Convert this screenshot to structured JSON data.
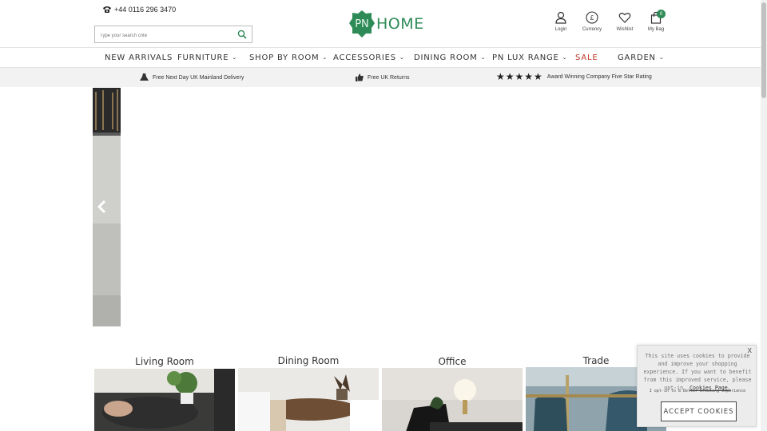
{
  "header": {
    "phone": "+44 0116 296 3470",
    "search_placeholder": "Type your search crite",
    "logo_mark": "PN",
    "logo_text": "HOME",
    "account_links": [
      {
        "label": "Login",
        "icon": "user-icon"
      },
      {
        "label": "Currency",
        "icon": "currency-icon",
        "glyph": "£"
      },
      {
        "label": "Wishlist",
        "icon": "heart-icon"
      },
      {
        "label": "My Bag",
        "icon": "bag-icon",
        "count": "0"
      }
    ]
  },
  "nav": {
    "items": [
      {
        "label": "NEW ARRIVALS",
        "has_dropdown": false
      },
      {
        "label": "FURNITURE",
        "has_dropdown": true
      },
      {
        "label": "SHOP BY ROOM",
        "has_dropdown": true
      },
      {
        "label": "ACCESSORIES",
        "has_dropdown": true
      },
      {
        "label": "DINING ROOM",
        "has_dropdown": true
      },
      {
        "label": "PN LUX RANGE",
        "has_dropdown": true
      },
      {
        "label": "SALE",
        "has_dropdown": false
      },
      {
        "label": "GARDEN",
        "has_dropdown": true
      }
    ],
    "chevron": "⌄"
  },
  "usp": {
    "delivery": "Free Next Day UK Mainland Delivery",
    "returns": "Free UK Returns",
    "stars": "★★★★★",
    "rating": "Award Winning Company Five Star Rating"
  },
  "categories": [
    {
      "title": "Living Room"
    },
    {
      "title": "Dining Room"
    },
    {
      "title": "Office"
    },
    {
      "title": "Trade"
    }
  ],
  "cookie": {
    "close": "X",
    "message": "This site uses cookies to provide and improve your shopping experience. If you want to benefit from this improved service, please opt-in.",
    "link": "Cookies Page.",
    "opt_in": "I opt-in to a better browsing experience",
    "accept": "ACCEPT COOKIES"
  },
  "colors": {
    "brand": "#2e8b57",
    "sale": "#c0392b",
    "usp_bg": "#f2f2f2"
  }
}
